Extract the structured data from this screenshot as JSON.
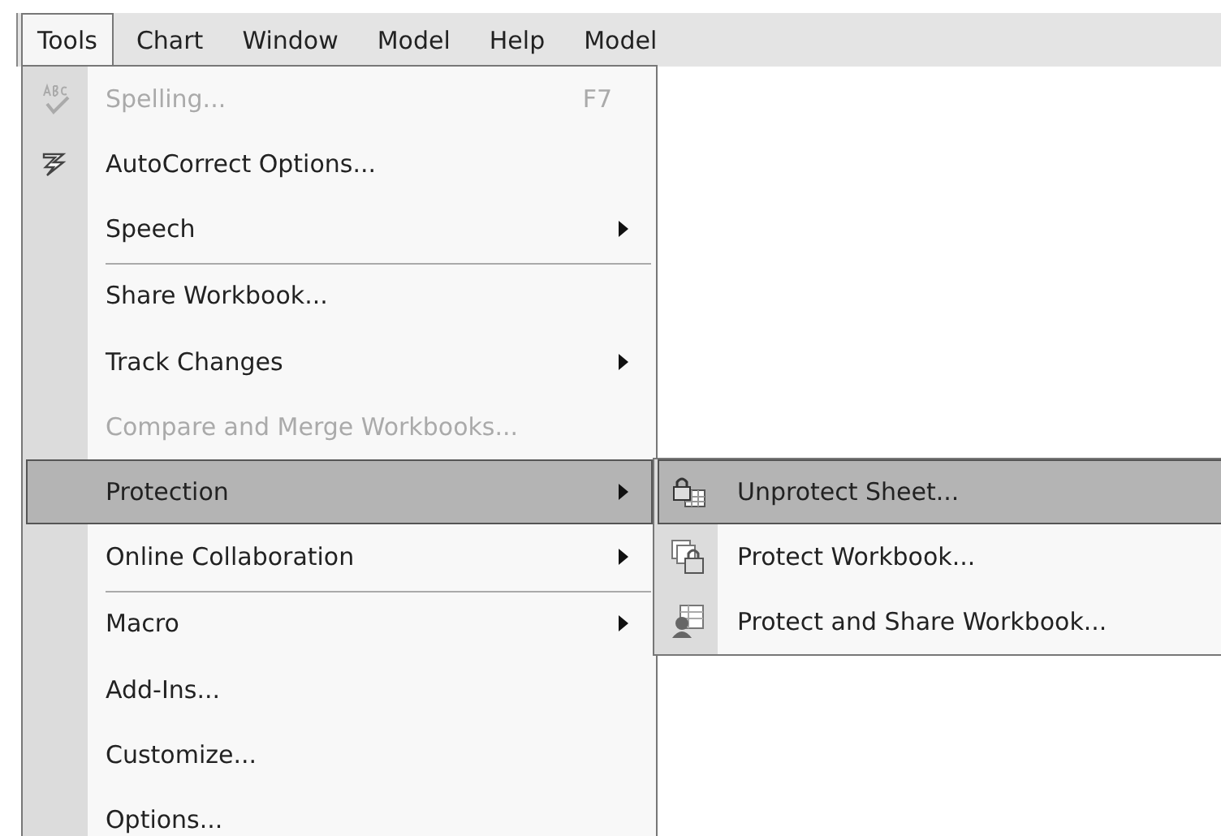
{
  "menubar": [
    {
      "label": "Tools",
      "selected": true
    },
    {
      "label": "Chart",
      "selected": false
    },
    {
      "label": "Window",
      "selected": false
    },
    {
      "label": "Model",
      "selected": false
    },
    {
      "label": "Help",
      "selected": false
    },
    {
      "label": "Model",
      "selected": false
    }
  ],
  "tools_menu": [
    {
      "label": "Spelling...",
      "shortcut": "F7",
      "disabled": true,
      "submenu": false,
      "selected": false,
      "separator_before": false
    },
    {
      "label": "AutoCorrect Options...",
      "disabled": false,
      "submenu": false,
      "selected": false,
      "separator_before": false
    },
    {
      "label": "Speech",
      "disabled": false,
      "submenu": true,
      "selected": false,
      "separator_before": false
    },
    {
      "label": "Share Workbook...",
      "disabled": false,
      "submenu": false,
      "selected": false,
      "separator_before": true
    },
    {
      "label": "Track Changes",
      "disabled": false,
      "submenu": true,
      "selected": false,
      "separator_before": false
    },
    {
      "label": "Compare and Merge Workbooks...",
      "disabled": true,
      "submenu": false,
      "selected": false,
      "separator_before": false
    },
    {
      "label": "Protection",
      "disabled": false,
      "submenu": true,
      "selected": true,
      "separator_before": false
    },
    {
      "label": "Online Collaboration",
      "disabled": false,
      "submenu": true,
      "selected": false,
      "separator_before": false
    },
    {
      "label": "Macro",
      "disabled": false,
      "submenu": true,
      "selected": false,
      "separator_before": true
    },
    {
      "label": "Add-Ins...",
      "disabled": false,
      "submenu": false,
      "selected": false,
      "separator_before": false
    },
    {
      "label": "Customize...",
      "disabled": false,
      "submenu": false,
      "selected": false,
      "separator_before": false
    },
    {
      "label": "Options...",
      "disabled": false,
      "submenu": false,
      "selected": false,
      "separator_before": false
    }
  ],
  "protection_submenu": [
    {
      "label": "Unprotect Sheet...",
      "selected": true
    },
    {
      "label": "Protect Workbook...",
      "selected": false
    },
    {
      "label": "Protect and Share Workbook...",
      "selected": false
    }
  ]
}
